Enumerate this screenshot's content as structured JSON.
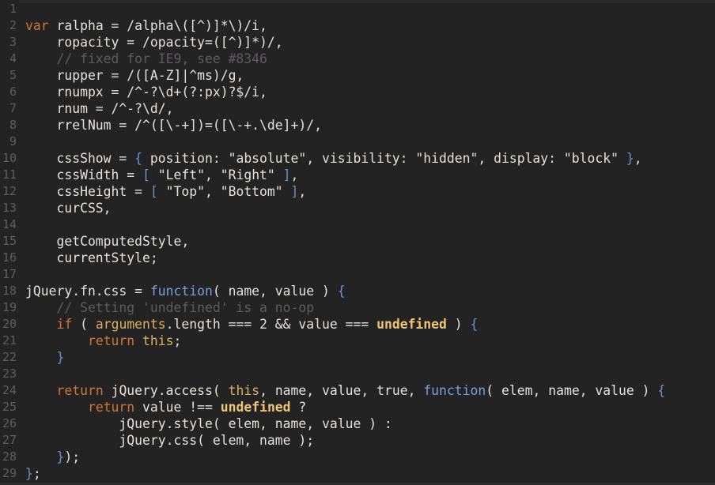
{
  "editor": {
    "lines": [
      {
        "n": "1",
        "tokens": []
      },
      {
        "n": "2",
        "tokens": [
          {
            "t": "var",
            "c": "kw"
          },
          {
            "t": " ralpha = /alpha\\([^)]*\\)/i,",
            "c": "plain"
          }
        ]
      },
      {
        "n": "3",
        "tokens": [
          {
            "t": "    ropacity = /opacity=([^)]*)/,",
            "c": "plain"
          }
        ]
      },
      {
        "n": "4",
        "tokens": [
          {
            "t": "    // fixed for IE9, see #8346",
            "c": "cm"
          }
        ]
      },
      {
        "n": "5",
        "tokens": [
          {
            "t": "    rupper = /([A-Z]|^ms)/g,",
            "c": "plain"
          }
        ]
      },
      {
        "n": "6",
        "tokens": [
          {
            "t": "    rnumpx = /^-?\\d+(?:px)?$/i,",
            "c": "plain"
          }
        ]
      },
      {
        "n": "7",
        "tokens": [
          {
            "t": "    rnum = /^-?\\d/,",
            "c": "plain"
          }
        ]
      },
      {
        "n": "8",
        "tokens": [
          {
            "t": "    rrelNum = /^([\\-+])=([\\-+.\\de]+)/,",
            "c": "plain"
          }
        ]
      },
      {
        "n": "9",
        "tokens": []
      },
      {
        "n": "10",
        "tokens": [
          {
            "t": "    cssShow = ",
            "c": "plain"
          },
          {
            "t": "{",
            "c": "brace"
          },
          {
            "t": " position: \"absolute\", visibility: \"hidden\", display: \"block\" ",
            "c": "plain"
          },
          {
            "t": "}",
            "c": "brace"
          },
          {
            "t": ",",
            "c": "plain"
          }
        ]
      },
      {
        "n": "11",
        "tokens": [
          {
            "t": "    cssWidth = ",
            "c": "plain"
          },
          {
            "t": "[",
            "c": "brace"
          },
          {
            "t": " \"Left\", \"Right\" ",
            "c": "plain"
          },
          {
            "t": "]",
            "c": "brace"
          },
          {
            "t": ",",
            "c": "plain"
          }
        ]
      },
      {
        "n": "12",
        "tokens": [
          {
            "t": "    cssHeight = ",
            "c": "plain"
          },
          {
            "t": "[",
            "c": "brace"
          },
          {
            "t": " \"Top\", \"Bottom\" ",
            "c": "plain"
          },
          {
            "t": "]",
            "c": "brace"
          },
          {
            "t": ",",
            "c": "plain"
          }
        ]
      },
      {
        "n": "13",
        "tokens": [
          {
            "t": "    curCSS,",
            "c": "plain"
          }
        ]
      },
      {
        "n": "14",
        "tokens": []
      },
      {
        "n": "15",
        "tokens": [
          {
            "t": "    getComputedStyle,",
            "c": "plain"
          }
        ]
      },
      {
        "n": "16",
        "tokens": [
          {
            "t": "    currentStyle;",
            "c": "plain"
          }
        ]
      },
      {
        "n": "17",
        "tokens": []
      },
      {
        "n": "18",
        "tokens": [
          {
            "t": "jQuery.fn.css = ",
            "c": "plain"
          },
          {
            "t": "function",
            "c": "fn"
          },
          {
            "t": "( name, value ) ",
            "c": "plain"
          },
          {
            "t": "{",
            "c": "brace"
          }
        ]
      },
      {
        "n": "19",
        "tokens": [
          {
            "t": "    // Setting 'undefined' is a no-op",
            "c": "cm"
          }
        ]
      },
      {
        "n": "20",
        "tokens": [
          {
            "t": "    ",
            "c": "plain"
          },
          {
            "t": "if",
            "c": "kw"
          },
          {
            "t": " ( ",
            "c": "plain"
          },
          {
            "t": "arguments",
            "c": "builtin"
          },
          {
            "t": ".length === 2 && value === ",
            "c": "plain"
          },
          {
            "t": "undefined",
            "c": "undef"
          },
          {
            "t": " ) ",
            "c": "plain"
          },
          {
            "t": "{",
            "c": "brace"
          }
        ]
      },
      {
        "n": "21",
        "tokens": [
          {
            "t": "        ",
            "c": "plain"
          },
          {
            "t": "return",
            "c": "kw"
          },
          {
            "t": " ",
            "c": "plain"
          },
          {
            "t": "this",
            "c": "builtin"
          },
          {
            "t": ";",
            "c": "plain"
          }
        ]
      },
      {
        "n": "22",
        "tokens": [
          {
            "t": "    ",
            "c": "plain"
          },
          {
            "t": "}",
            "c": "brace"
          }
        ]
      },
      {
        "n": "23",
        "tokens": []
      },
      {
        "n": "24",
        "tokens": [
          {
            "t": "    ",
            "c": "plain"
          },
          {
            "t": "return",
            "c": "kw"
          },
          {
            "t": " jQuery.access( ",
            "c": "plain"
          },
          {
            "t": "this",
            "c": "builtin"
          },
          {
            "t": ", name, value, true, ",
            "c": "plain"
          },
          {
            "t": "function",
            "c": "fn"
          },
          {
            "t": "( elem, name, value ) ",
            "c": "plain"
          },
          {
            "t": "{",
            "c": "brace"
          }
        ]
      },
      {
        "n": "25",
        "tokens": [
          {
            "t": "        ",
            "c": "plain"
          },
          {
            "t": "return",
            "c": "kw"
          },
          {
            "t": " value !== ",
            "c": "plain"
          },
          {
            "t": "undefined",
            "c": "undef"
          },
          {
            "t": " ?",
            "c": "plain"
          }
        ]
      },
      {
        "n": "26",
        "tokens": [
          {
            "t": "            jQuery.style( elem, name, value ) :",
            "c": "plain"
          }
        ]
      },
      {
        "n": "27",
        "tokens": [
          {
            "t": "            jQuery.css( elem, name );",
            "c": "plain"
          }
        ]
      },
      {
        "n": "28",
        "tokens": [
          {
            "t": "    ",
            "c": "plain"
          },
          {
            "t": "}",
            "c": "brace"
          },
          {
            "t": ");",
            "c": "plain"
          }
        ]
      },
      {
        "n": "29",
        "tokens": [
          {
            "t": "}",
            "c": "brace"
          },
          {
            "t": ";",
            "c": "plain"
          }
        ]
      }
    ]
  }
}
